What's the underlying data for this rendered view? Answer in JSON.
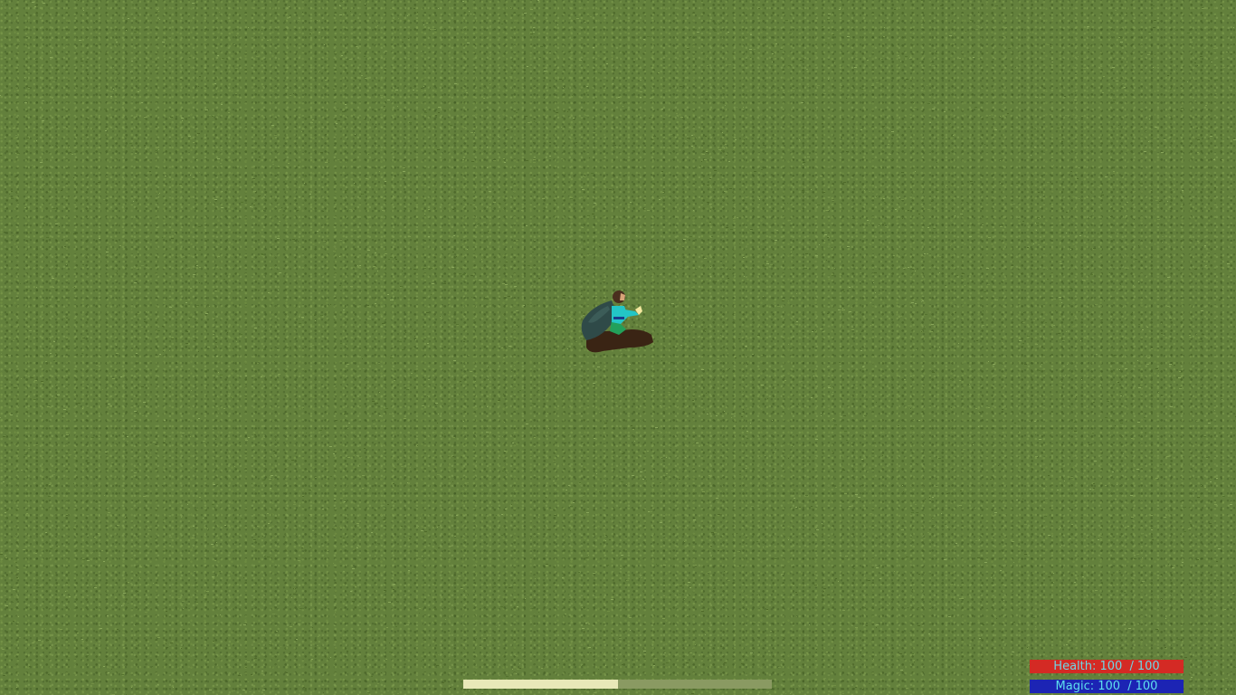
{
  "hud": {
    "health": {
      "label": "Health:",
      "current": "100",
      "separator": "/",
      "max": "100",
      "color": "#d42a24"
    },
    "magic": {
      "label": "Magic:",
      "current": "100",
      "separator": "/",
      "max": "100",
      "color": "#1c24b4"
    },
    "cast_bar": {
      "progress": 0.5,
      "fill_color": "#e8e8b8",
      "track_color": "#8a9a62"
    }
  },
  "world": {
    "terrain": "grass",
    "ground_color": "#63803c"
  },
  "player": {
    "sprite": "caped-hero-crouching",
    "cape_color": "#2f4a48",
    "tunic_color": "#23c6c6",
    "pants_color": "#22a05a"
  }
}
